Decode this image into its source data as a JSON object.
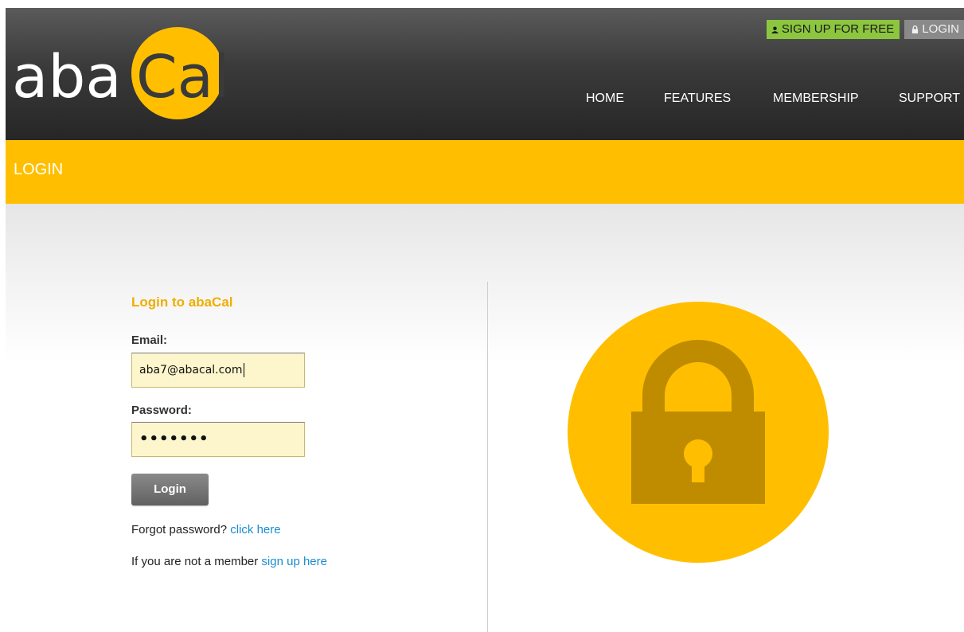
{
  "brand": {
    "logo_left": "aba",
    "logo_right": "Cal",
    "logo_color": "#ffbf00"
  },
  "top_buttons": {
    "signup_label": "SIGN UP FOR FREE",
    "login_label": "LOGIN"
  },
  "nav": {
    "items": [
      "HOME",
      "FEATURES",
      "MEMBERSHIP",
      "SUPPORT"
    ]
  },
  "band": {
    "title": "LOGIN"
  },
  "form": {
    "title": "Login to abaCal",
    "email_label": "Email:",
    "email_value": "aba7@abacal.com",
    "password_label": "Password:",
    "password_value": "•••••••",
    "submit_label": "Login",
    "forgot_text": "Forgot password?",
    "forgot_link": "click here",
    "member_text": "If you are not a member",
    "member_link": "sign up here"
  },
  "colors": {
    "accent": "#ffbf00",
    "signup_green": "#8cc63f",
    "link": "#1a8ccf",
    "lock_dark": "#bf8c00"
  },
  "icons": {
    "signup": "user-icon",
    "login": "lock-icon",
    "hero": "padlock-icon"
  }
}
